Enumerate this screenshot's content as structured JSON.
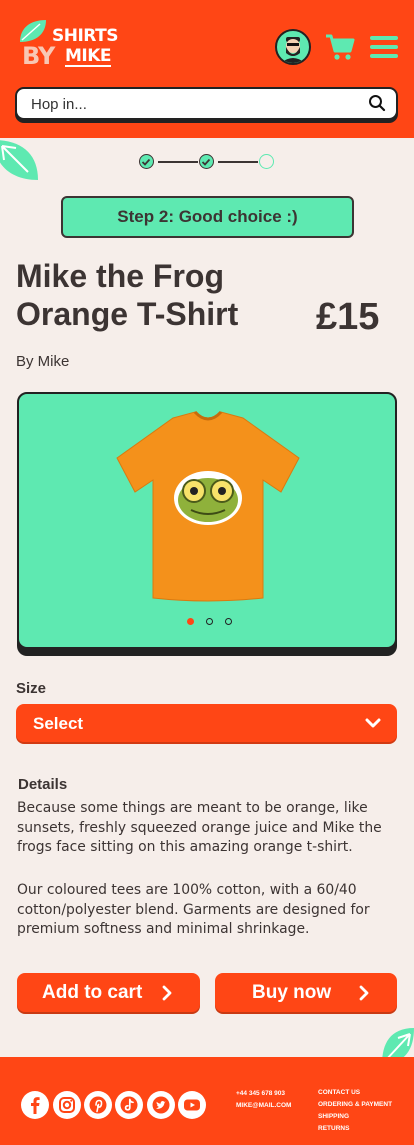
{
  "header": {
    "logo": {
      "word1": "SHIRTS",
      "word2": "BY",
      "word3": "MIKE"
    },
    "search_placeholder": "Hop in..."
  },
  "stepper": {
    "steps": [
      "done",
      "done",
      "todo"
    ]
  },
  "step_banner": "Step 2: Good choice :)",
  "product": {
    "title": "Mike the Frog Orange T-Shirt",
    "price": "£15",
    "byline": "By Mike",
    "carousel": {
      "count": 3,
      "active_index": 0
    }
  },
  "size": {
    "label": "Size",
    "selected": "Select"
  },
  "details": {
    "label": "Details",
    "paragraph1": "Because some things are meant to be orange, like sunsets, freshly squeezed orange juice and Mike the frogs face sitting on this amazing orange t-shirt.",
    "paragraph2": "Our coloured tees are 100% cotton, with a 60/40 cotton/polyester blend. Garments are designed for premium softness and minimal shrinkage."
  },
  "actions": {
    "add_to_cart": "Add to cart",
    "buy_now": "Buy now"
  },
  "footer": {
    "social": [
      "facebook-icon",
      "instagram-icon",
      "pinterest-icon",
      "tiktok-icon",
      "twitter-icon",
      "youtube-icon"
    ],
    "phone": "+44 345 678 903",
    "email": "MIKE@MAIL.COM",
    "links": [
      "CONTACT US",
      "ORDERING & PAYMENT",
      "SHIPPING",
      "RETURNS"
    ]
  },
  "colors": {
    "brand": "#ff4615",
    "accent": "#5ee9b1",
    "background": "#f6eeea",
    "text": "#3c3433"
  }
}
